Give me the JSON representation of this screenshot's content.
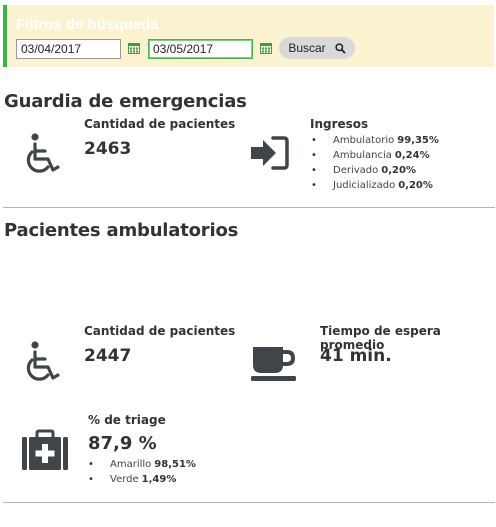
{
  "filters": {
    "title": "Filtros de búsqueda",
    "date_from": "03/04/2017",
    "date_to": "03/05/2017",
    "search_label": "Buscar"
  },
  "emergency": {
    "title": "Guardia de emergencias",
    "patients_label": "Cantidad de pacientes",
    "patients_value": "2463",
    "admissions_label": "Ingresos",
    "admissions": [
      {
        "name": "Ambulatorio",
        "value": "99,35%"
      },
      {
        "name": "Ambulancia",
        "value": "0,24%"
      },
      {
        "name": "Derivado",
        "value": "0,20%"
      },
      {
        "name": "Judicializado",
        "value": "0,20%"
      }
    ]
  },
  "ambulatory": {
    "title": "Pacientes ambulatorios",
    "patients_label": "Cantidad de pacientes",
    "patients_value": "2447",
    "wait_label": "Tiempo de espera promedio",
    "wait_value": "41 min.",
    "triage_label": "% de triage",
    "triage_value": "87,9 %",
    "triage": [
      {
        "name": "Amarillo",
        "value": "98,51%"
      },
      {
        "name": "Verde",
        "value": "1,49%"
      }
    ]
  },
  "icons": {
    "calendar": "calendar-icon",
    "search": "magnifier-icon",
    "wheelchair": "wheelchair-icon",
    "sign_in": "sign-in-icon",
    "coffee": "coffee-cup-icon",
    "medkit": "medkit-icon"
  },
  "colors": {
    "filter_bg": "#fbf3d0",
    "filter_accent": "#38b44a",
    "icon": "#3f4548"
  }
}
